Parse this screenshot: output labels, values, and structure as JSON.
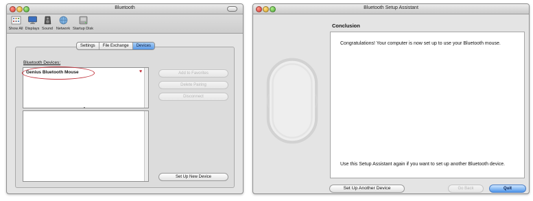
{
  "left_window": {
    "title": "Bluetooth",
    "toolbar": [
      "Show All",
      "Displays",
      "Sound",
      "Network",
      "Startup Disk"
    ],
    "tabs": [
      {
        "label": "Settings",
        "active": false
      },
      {
        "label": "File Exchange",
        "active": false
      },
      {
        "label": "Devices",
        "active": true
      }
    ],
    "devices_label": "Bluetooth Devices:",
    "devices": [
      {
        "name": "Genius Bluetooth Mouse"
      }
    ],
    "buttons": {
      "add_favorites": "Add to Favorites",
      "delete_pairing": "Delete Pairing",
      "disconnect": "Disconnect",
      "setup_new": "Set Up New Device"
    }
  },
  "right_window": {
    "title": "Bluetooth Setup Assistant",
    "heading": "Conclusion",
    "message": "Congratulations! Your computer is now set up to use your Bluetooth mouse.",
    "footer_note": "Use this Setup Assistant again if you want to set up another Bluetooth device.",
    "buttons": {
      "setup_another": "Set Up Another Device",
      "go_back": "Go Back",
      "quit": "Quit"
    }
  },
  "colors": {
    "highlight_oval": "#c0303a",
    "default_button": "#4e95e9",
    "active_tab": "#5a99e6"
  },
  "icons": [
    "show-all-grid-icon",
    "displays-icon",
    "sound-speaker-icon",
    "network-globe-icon",
    "startup-disk-icon",
    "heart-icon",
    "battery-level-icon",
    "mouse-outline-icon"
  ]
}
